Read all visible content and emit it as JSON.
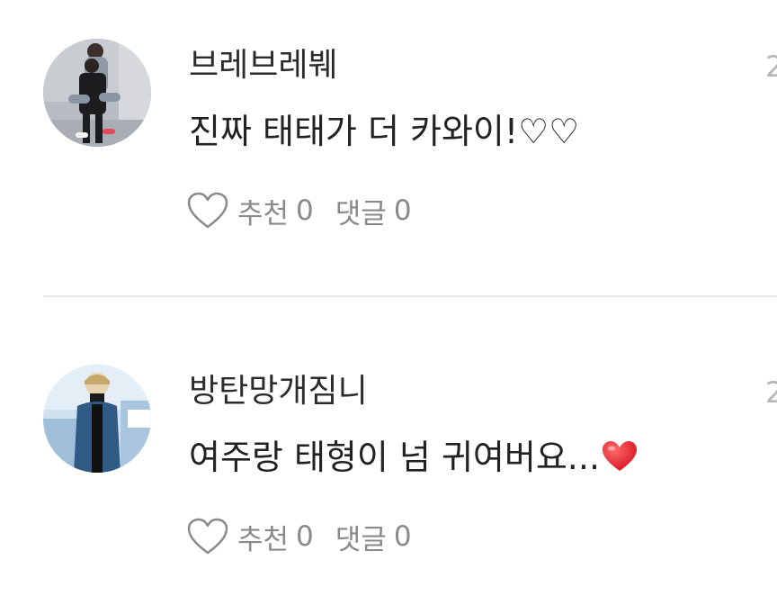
{
  "comments": [
    {
      "username": "브레브레붸",
      "text": "진짜 태태가 더 카와이!♡♡",
      "timestamp": "2",
      "like_label": "추천",
      "like_count": "0",
      "reply_label": "댓글",
      "reply_count": "0"
    },
    {
      "username": "방탄망개짐니",
      "text": "여주랑 태형이 넘 귀여버요...",
      "emoji": "red-heart",
      "timestamp": "2",
      "like_label": "추천",
      "like_count": "0",
      "reply_label": "댓글",
      "reply_count": "0"
    }
  ],
  "colors": {
    "username": "#2b2b2b",
    "text": "#222222",
    "meta": "#8a8a8a",
    "timestamp": "#b5b5b5",
    "divider": "#e8e8e8",
    "emoji_heart": "#e8252f"
  },
  "icons": {
    "like": "heart-outline-icon",
    "emoji": "red-heart-emoji"
  }
}
